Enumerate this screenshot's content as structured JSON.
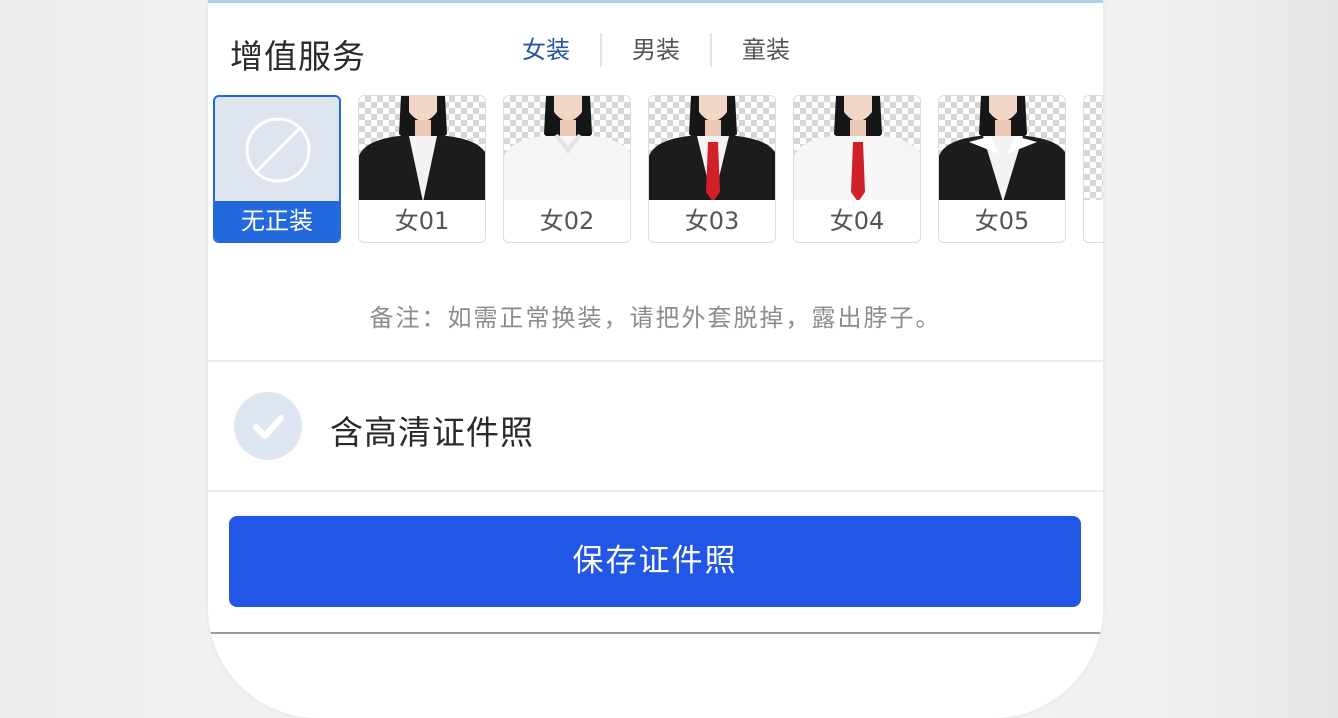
{
  "section": {
    "title": "增值服务"
  },
  "tabs": [
    {
      "label": "女装",
      "active": true
    },
    {
      "label": "男装",
      "active": false
    },
    {
      "label": "童装",
      "active": false
    }
  ],
  "outfits": [
    {
      "label": "无正装",
      "selected": true
    },
    {
      "label": "女01",
      "jacket": "#1e1e1e",
      "shirt": "#f3f3f3",
      "tie": null
    },
    {
      "label": "女02",
      "jacket": null,
      "shirt": "#f5f5f5",
      "tie": null
    },
    {
      "label": "女03",
      "jacket": "#1e1e1e",
      "shirt": "#f3f3f3",
      "tie": "#d0202a"
    },
    {
      "label": "女04",
      "jacket": null,
      "shirt": "#f5f5f5",
      "tie": "#d0202a"
    },
    {
      "label": "女05",
      "jacket": "#1e1e1e",
      "shirt": "#f3f3f3",
      "tie": null
    }
  ],
  "note": "备注：如需正常换装，请把外套脱掉，露出脖子。",
  "hd_option": {
    "label": "含高清证件照",
    "checked": true
  },
  "save_button": {
    "label": "保存证件照"
  },
  "colors": {
    "accent": "#2256e6",
    "selected_border": "#2468de",
    "active_tab": "#2656a8"
  }
}
